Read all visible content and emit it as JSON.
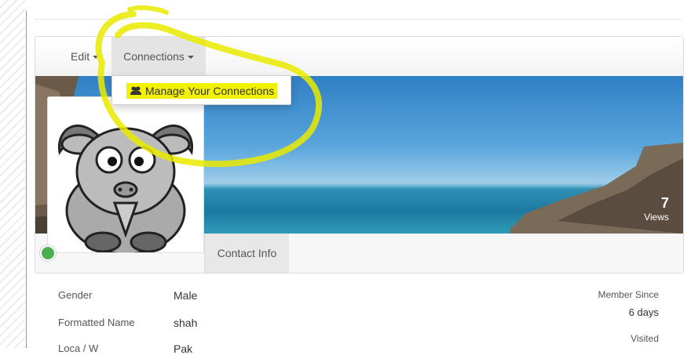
{
  "menu": {
    "edit_label": "Edit",
    "connections_label": "Connections"
  },
  "dropdown": {
    "manage_connections_label": "Manage Your Connections"
  },
  "cover": {
    "views_count": "7",
    "views_label": "Views"
  },
  "tabs": {
    "contact_info_label": "Contact Info"
  },
  "profile_fields": [
    {
      "label": "Gender",
      "value": "Male"
    },
    {
      "label": "Formatted Name",
      "value": "shah"
    },
    {
      "label": "Loca / W",
      "value": "Pak"
    }
  ],
  "sidebar_stats": {
    "member_since_label": "Member Since",
    "member_since_value": "6 days",
    "visited_label": "Visited"
  },
  "colors": {
    "highlight": "#f2f200",
    "accent_green": "#4caf50",
    "page_rule": "#5fb85f"
  },
  "icons": {
    "people": "users-icon",
    "caret": "caret-down-icon"
  }
}
